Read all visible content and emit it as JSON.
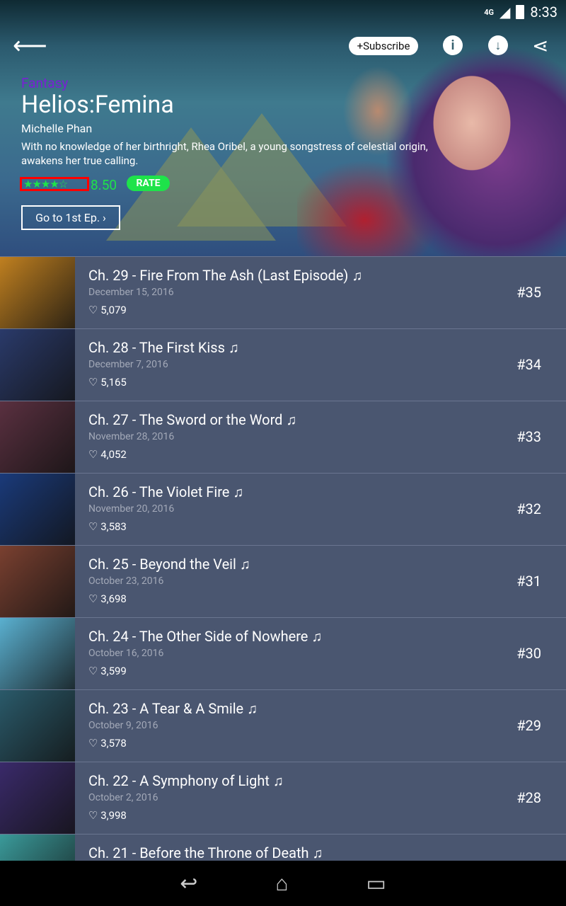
{
  "status": {
    "network": "4G",
    "time": "8:33"
  },
  "header": {
    "subscribe_label": "+Subscribe",
    "genre": "Fantasy",
    "title": "Helios:Femina",
    "author": "Michelle Phan",
    "description": "With no knowledge of her birthright, Rhea Oribel, a young songstress of celestial origin, awakens her true calling.",
    "stars": "★★★★☆",
    "rating": "8.50",
    "rate_label": "RATE",
    "first_ep_label": "Go to 1st Ep. ›"
  },
  "episodes": [
    {
      "title": "Ch. 29 - Fire From The Ash (Last Episode) ♫",
      "date": "December 15, 2016",
      "likes": "5,079",
      "num": "#35",
      "thumb": "#c08020"
    },
    {
      "title": "Ch. 28 - The First Kiss ♫",
      "date": "December 7, 2016",
      "likes": "5,165",
      "num": "#34",
      "thumb": "#2a3a6a"
    },
    {
      "title": "Ch. 27 - The Sword or the Word ♫",
      "date": "November 28, 2016",
      "likes": "4,052",
      "num": "#33",
      "thumb": "#5a3040"
    },
    {
      "title": "Ch. 26 - The Violet Fire ♫",
      "date": "November 20, 2016",
      "likes": "3,583",
      "num": "#32",
      "thumb": "#1a3a7a"
    },
    {
      "title": "Ch. 25 - Beyond the Veil ♫",
      "date": "October 23, 2016",
      "likes": "3,698",
      "num": "#31",
      "thumb": "#7a4030"
    },
    {
      "title": "Ch. 24 - The Other Side of Nowhere ♫",
      "date": "October 16, 2016",
      "likes": "3,599",
      "num": "#30",
      "thumb": "#5ab0d0"
    },
    {
      "title": "Ch. 23 - A Tear & A Smile ♫",
      "date": "October 9, 2016",
      "likes": "3,578",
      "num": "#29",
      "thumb": "#2a5a6a"
    },
    {
      "title": "Ch. 22 - A Symphony of Light ♫",
      "date": "October 2, 2016",
      "likes": "3,998",
      "num": "#28",
      "thumb": "#3a2a6a"
    },
    {
      "title": "Ch. 21 - Before the Throne of Death ♫",
      "date": "",
      "likes": "",
      "num": "",
      "thumb": "#3a9a9a"
    }
  ],
  "colors": {
    "accent": "#1ee34a",
    "genre": "#7a1fd6",
    "list_bg": "#4a5670"
  }
}
